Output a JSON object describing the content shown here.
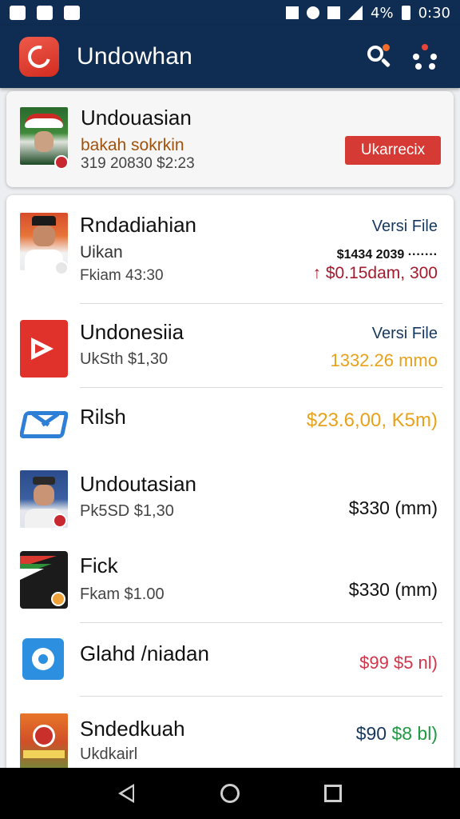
{
  "status_bar": {
    "battery": "4%",
    "time": "0:30"
  },
  "app_bar": {
    "title": "Undowhan",
    "icons": [
      "app-logo",
      "search-icon",
      "more-icon"
    ]
  },
  "featured": {
    "title": "Undouasian",
    "subtitle": "bakah sokrkin",
    "meta": "319 20830 $2:23",
    "button_label": "Ukarrecix"
  },
  "items": [
    {
      "title": "Rndadiahian",
      "subtitle": "Uikan",
      "meta": "Fkiam 43:30",
      "right_top": "Versi File",
      "right_mid": "$1434 2039 ·······",
      "right_bottom": "↑ $0.15dam, 300"
    },
    {
      "title": "Undonesiia",
      "meta": "UkSth $1,30",
      "right_top": "Versi File",
      "right_bottom": "1332.26 mmo"
    },
    {
      "title": "Rilsh",
      "right_mid": "$23.6,00, K5m)"
    },
    {
      "title": "Undoutasian",
      "meta": "Pk5SD $1,30",
      "right_mid": "$330 (mm)"
    },
    {
      "title": "Fick",
      "meta": "Fkam $1.00",
      "right_mid": "$330 (mm)"
    },
    {
      "title": "Glahd /niadan",
      "right_mid": "$99 $5 nl)"
    },
    {
      "title": "Sndedkuah",
      "meta": "Ukdkairl",
      "right_mid_a": "$90",
      "right_mid_b": "$8 bl)"
    }
  ],
  "colors": {
    "app_bar": "#0f2c52",
    "accent_red": "#d63a34",
    "price_orange": "#e8a21a",
    "price_red": "#d2344a",
    "price_navy": "#16385e",
    "price_green": "#1f9a43"
  }
}
